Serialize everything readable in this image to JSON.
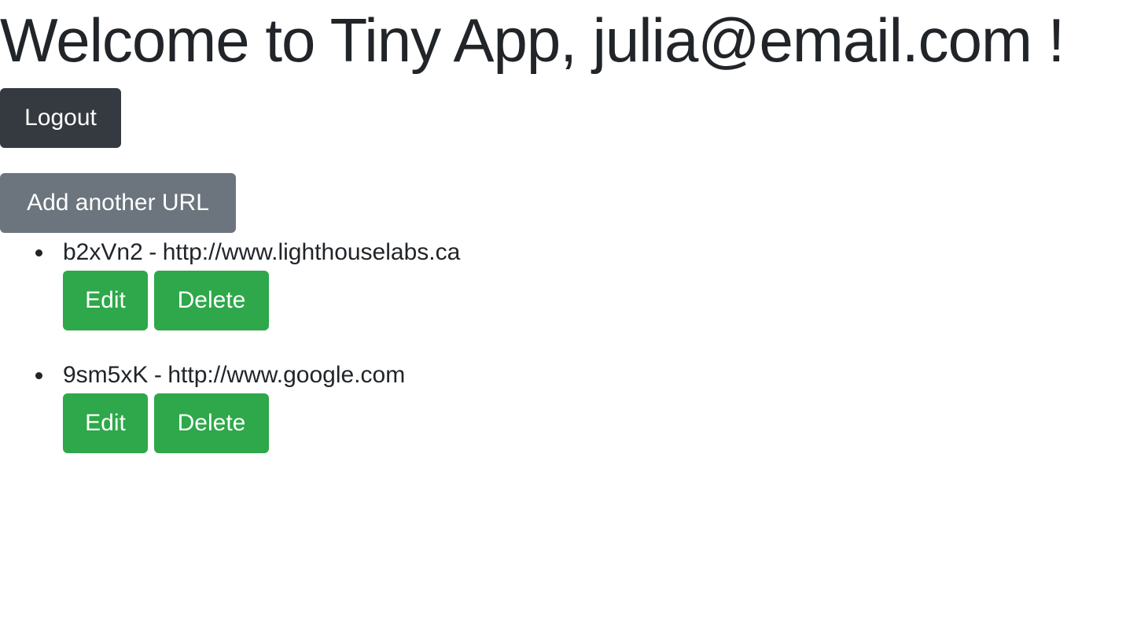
{
  "header": {
    "welcome_prefix": "Welcome to Tiny App, ",
    "user_email": "julia@email.com",
    "welcome_suffix": " !"
  },
  "actions": {
    "logout_label": "Logout",
    "add_url_label": "Add another URL"
  },
  "urls": [
    {
      "short_id": "b2xVn2",
      "separator": "-",
      "long_url": "http://www.lighthouselabs.ca",
      "edit_label": "Edit",
      "delete_label": "Delete"
    },
    {
      "short_id": "9sm5xK",
      "separator": "-",
      "long_url": "http://www.google.com",
      "edit_label": "Edit",
      "delete_label": "Delete"
    }
  ],
  "colors": {
    "text": "#212529",
    "logout_button": "#343a40",
    "add_url_button": "#6c757d",
    "action_button": "#2ea84a"
  }
}
